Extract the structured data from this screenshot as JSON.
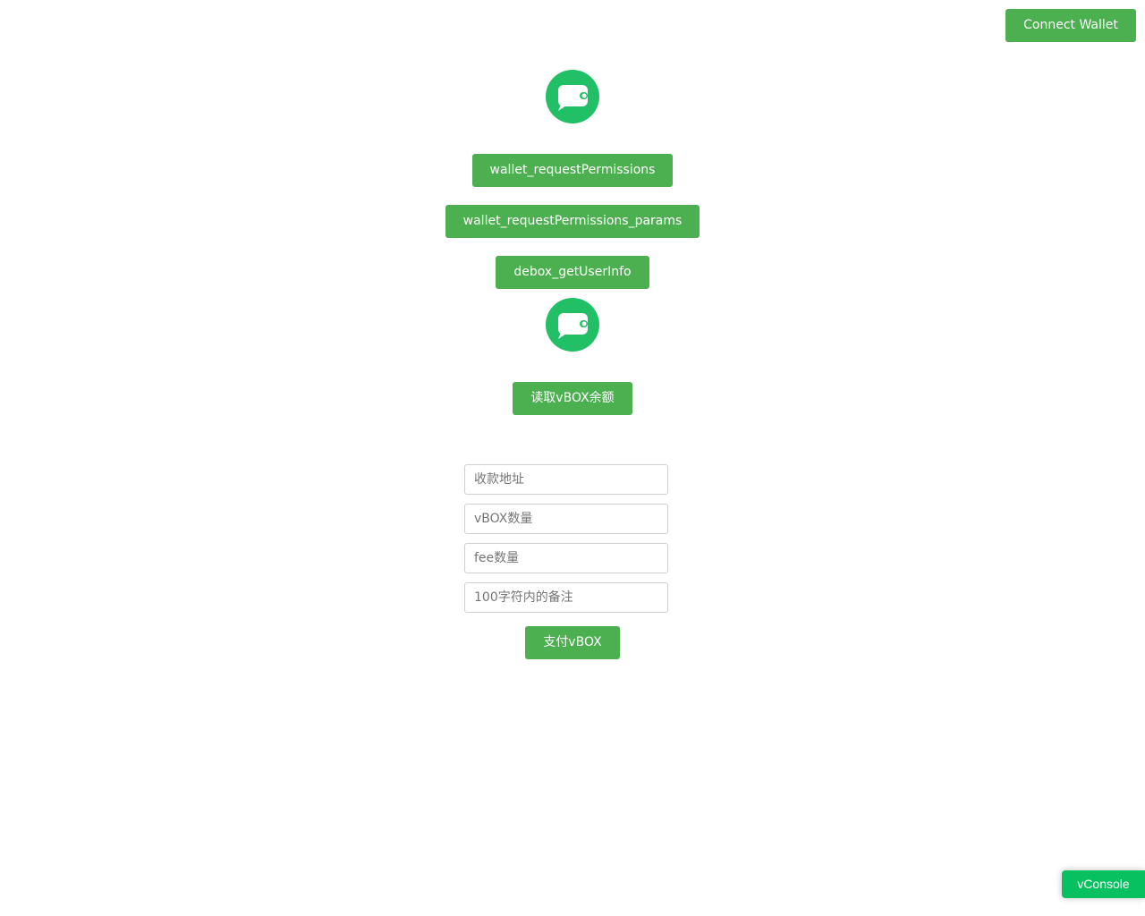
{
  "header": {
    "connect_wallet_label": "Connect Wallet"
  },
  "section_permissions": {
    "icon": "wallet-icon",
    "buttons": [
      {
        "label": "wallet_requestPermissions"
      },
      {
        "label": "wallet_requestPermissions_params"
      },
      {
        "label": "debox_getUserInfo"
      }
    ]
  },
  "section_balance": {
    "icon": "wallet-icon",
    "read_balance_label": "读取vBOX余额"
  },
  "payment_form": {
    "address_placeholder": "收款地址",
    "amount_placeholder": "vBOX数量",
    "fee_placeholder": "fee数量",
    "memo_placeholder": "100字符内的备注",
    "pay_label": "支付vBOX"
  },
  "debug": {
    "vconsole_label": "vConsole"
  },
  "colors": {
    "button": "#4caf50",
    "icon_badge": "#22c066",
    "vconsole": "#07c160"
  }
}
